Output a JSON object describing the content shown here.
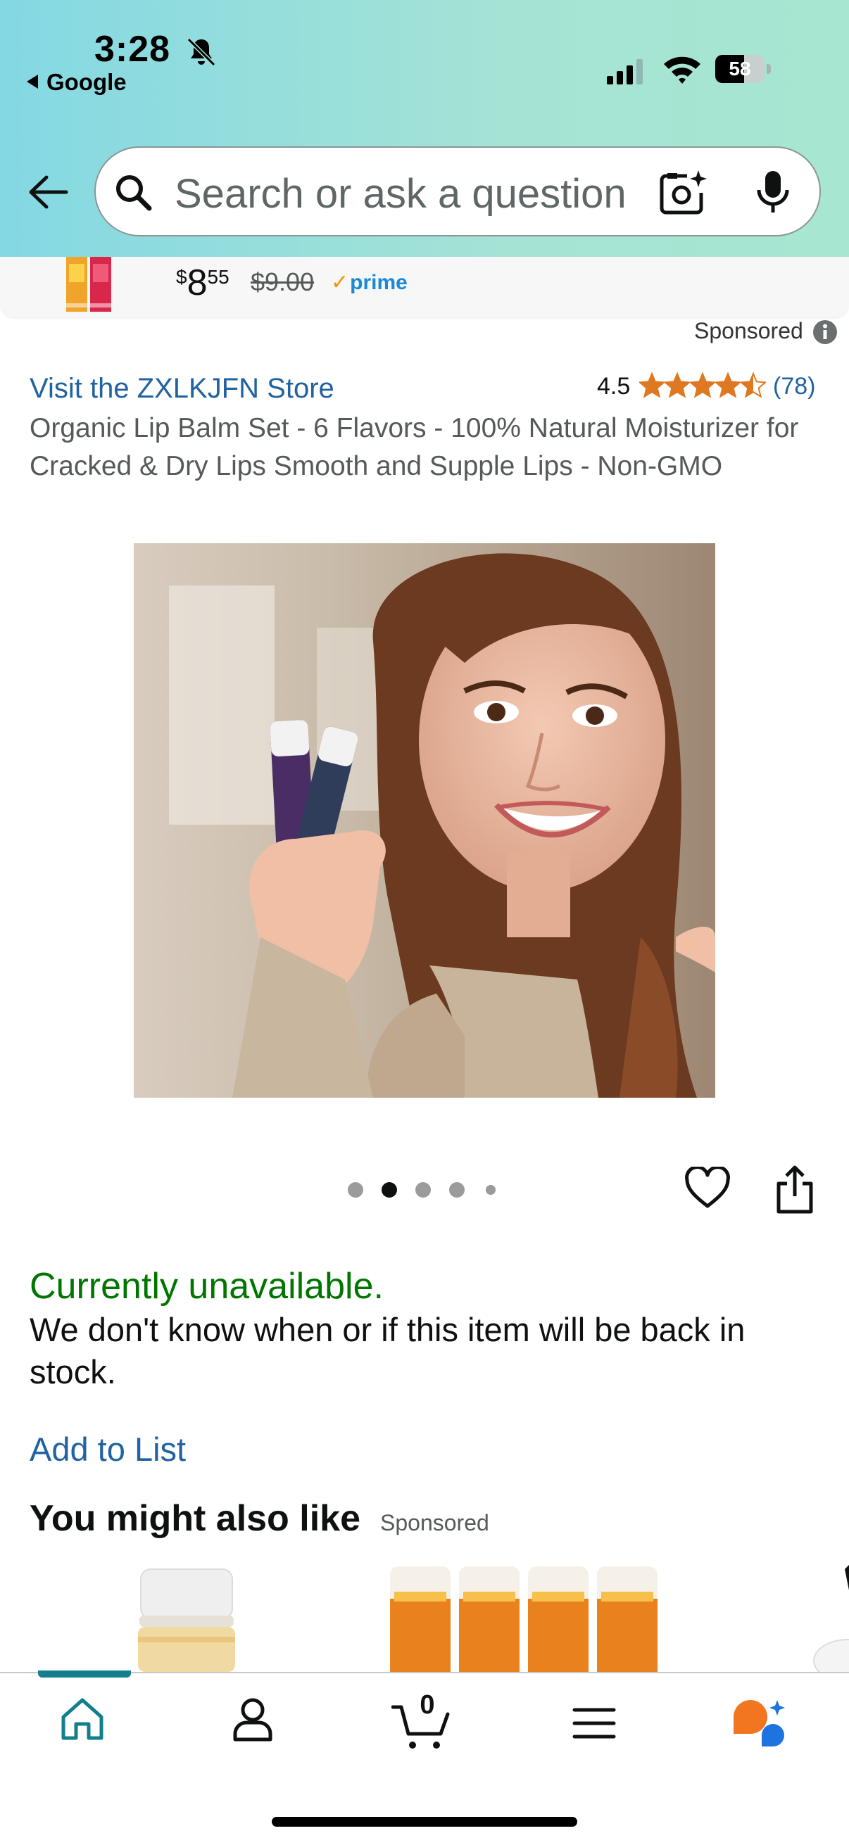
{
  "status_bar": {
    "time": "3:28",
    "back_app": "Google",
    "battery": "58",
    "battery_level": 0.58
  },
  "search": {
    "placeholder": "Search or ask a question"
  },
  "sticky_product": {
    "currency": "$",
    "price_whole": "8",
    "price_fraction": "55",
    "old_price": "$9.00",
    "prime_label": "prime"
  },
  "product": {
    "sponsored_label": "Sponsored",
    "store_link": "Visit the ZXLKJFN Store",
    "rating": "4.5",
    "rating_value": 4.5,
    "rating_count": "(78)",
    "title": "Organic Lip Balm Set - 6 Flavors - 100% Natural Moisturizer for Cracked & Dry Lips Smooth and Supple Lips - Non-GMO",
    "image_count": 5,
    "active_image_index": 1
  },
  "availability": {
    "status": "Currently unavailable.",
    "message": "We don't know when or if this item will be back in stock."
  },
  "actions": {
    "add_to_list": "Add to List"
  },
  "recommendations": {
    "heading": "You might also like",
    "sponsored_label": "Sponsored"
  },
  "bottom_nav": {
    "items": [
      "home-icon",
      "account-icon",
      "cart-icon",
      "menu-icon",
      "rufus-icon"
    ],
    "cart_count": "0",
    "active": "home"
  },
  "colors": {
    "link": "#2162a1",
    "available_green": "#007600",
    "teal_active": "#127f8c",
    "rufus_orange": "#f2751f",
    "rufus_blue": "#1d74e0"
  }
}
